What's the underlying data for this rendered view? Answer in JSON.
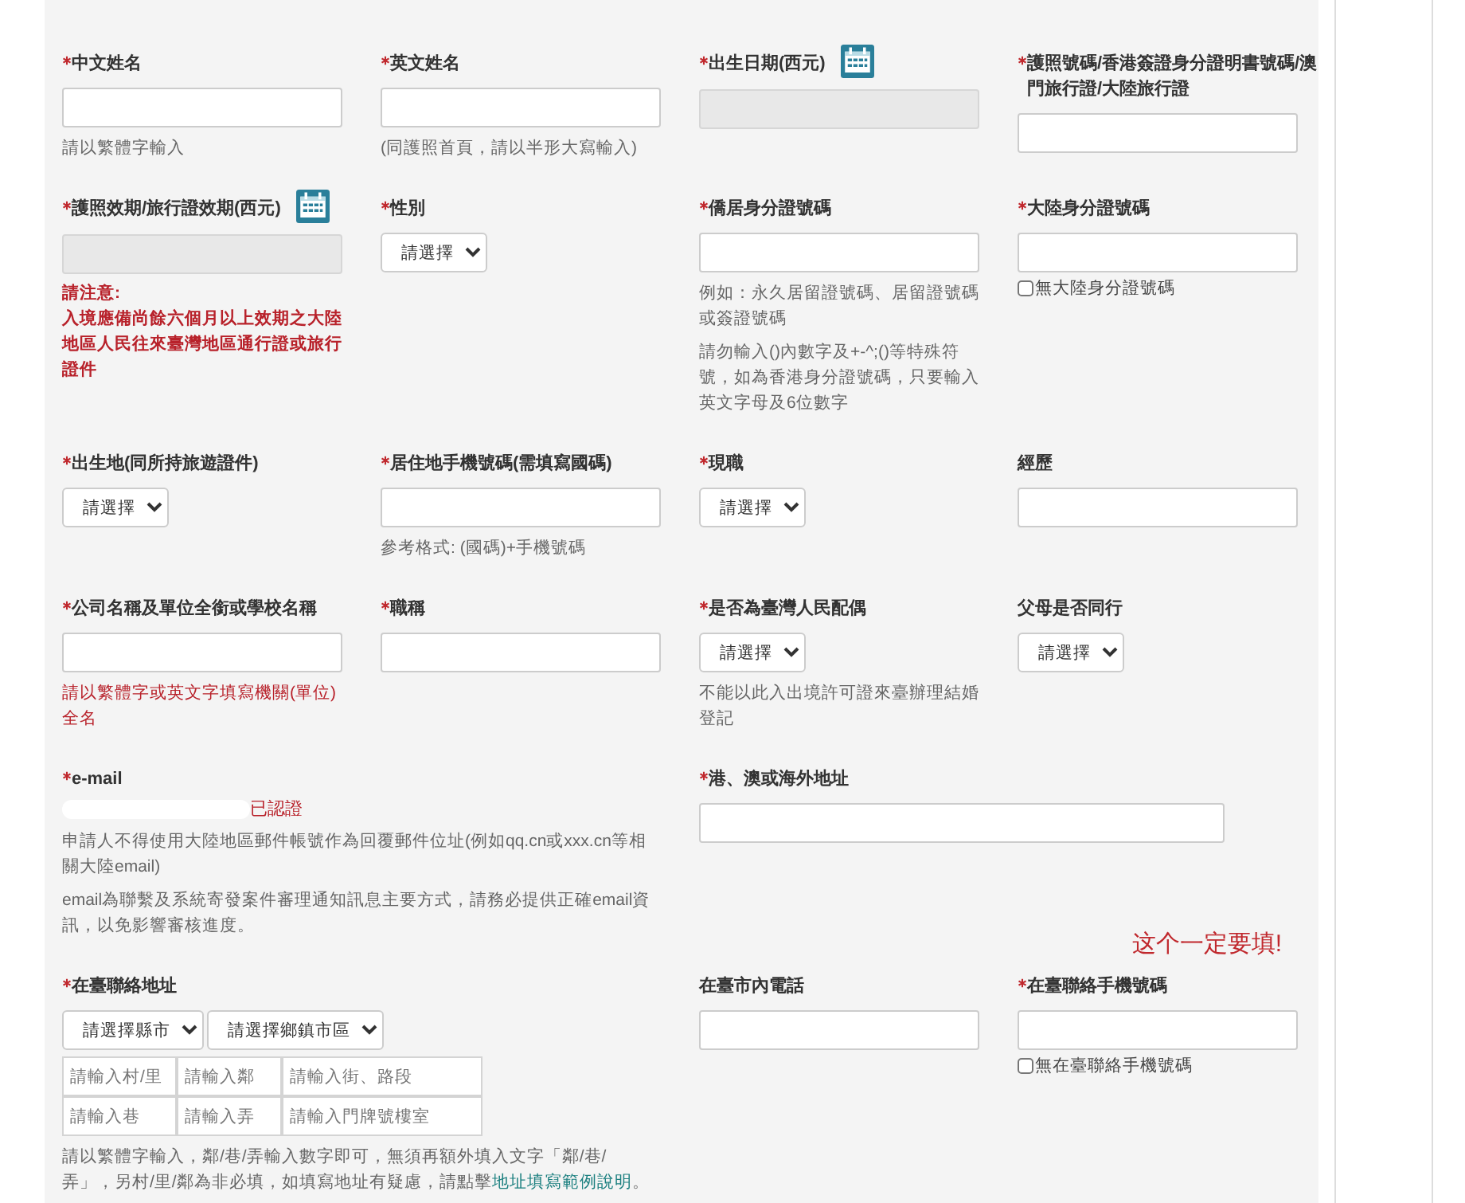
{
  "rows": [
    {
      "fields": [
        {
          "label": "中文姓名",
          "required": true,
          "kind": "text",
          "notes": [
            {
              "text": "請以繁體字輸入",
              "kind": "hint"
            }
          ]
        },
        {
          "label": "英文姓名",
          "required": true,
          "kind": "text",
          "notes": [
            {
              "text": "(同護照首頁，請以半形大寫輸入)",
              "kind": "hint"
            }
          ]
        },
        {
          "label": "出生日期(西元)",
          "required": true,
          "kind": "date"
        },
        {
          "label": "護照號碼/香港簽證身分證明書號碼/澳門旅行證/大陸旅行證",
          "required": true,
          "kind": "text"
        }
      ]
    },
    {
      "fields": [
        {
          "label": "護照效期/旅行證效期(西元)",
          "required": true,
          "kind": "date",
          "notes": [
            {
              "text": "請注意:",
              "kind": "alert"
            },
            {
              "text": "入境應備尚餘六個月以上效期之大陸地區人民往來臺灣地區通行證或旅行證件",
              "kind": "alert"
            }
          ]
        },
        {
          "label": "性別",
          "required": true,
          "kind": "select",
          "value": "請選擇"
        },
        {
          "label": "僑居身分證號碼",
          "required": true,
          "kind": "text",
          "notes": [
            {
              "text": "例如：永久居留證號碼、居留證號碼或簽證號碼",
              "kind": "hint"
            },
            {
              "text": "請勿輸入()內數字及+-^;()等特殊符號，如為香港身分證號碼，只要輸入英文字母及6位數字",
              "kind": "hint"
            }
          ]
        },
        {
          "label": "大陸身分證號碼",
          "required": true,
          "kind": "text",
          "checkbox": {
            "label": "無大陸身分證號碼",
            "checked": false
          }
        }
      ]
    },
    {
      "fields": [
        {
          "label": "出生地(同所持旅遊證件)",
          "required": true,
          "kind": "select",
          "value": "請選擇"
        },
        {
          "label": "居住地手機號碼(需填寫國碼)",
          "required": true,
          "kind": "text",
          "notes": [
            {
              "text": "參考格式: (國碼)+手機號碼",
              "kind": "hint"
            }
          ]
        },
        {
          "label": "現職",
          "required": true,
          "kind": "select",
          "value": "請選擇"
        },
        {
          "label": "經歷",
          "required": false,
          "kind": "text"
        }
      ]
    },
    {
      "fields": [
        {
          "label": "公司名稱及單位全銜或學校名稱",
          "required": true,
          "kind": "text",
          "notes": [
            {
              "text": "請以繁體字或英文字填寫機關(單位)全名",
              "kind": "error"
            }
          ]
        },
        {
          "label": "職稱",
          "required": true,
          "kind": "text"
        },
        {
          "label": "是否為臺灣人民配偶",
          "required": true,
          "kind": "select",
          "value": "請選擇",
          "notes": [
            {
              "text": "不能以此入出境許可證來臺辦理結婚登記",
              "kind": "hint"
            }
          ]
        },
        {
          "label": "父母是否同行",
          "required": false,
          "kind": "select",
          "value": "請選擇"
        }
      ]
    },
    {
      "fields": [
        {
          "label": "e-mail",
          "required": true,
          "kind": "email",
          "wide": true,
          "status": "已認證",
          "notes": [
            {
              "text": "申請人不得使用大陸地區郵件帳號作為回覆郵件位址(例如qq.cn或xxx.cn等相關大陸email)",
              "kind": "hint"
            },
            {
              "text": "email為聯繫及系統寄發案件審理通知訊息主要方式，請務必提供正確email資訊，以免影響審核進度。",
              "kind": "hint"
            }
          ]
        },
        {
          "label": "港、澳或海外地址",
          "required": true,
          "kind": "text",
          "wide": true
        }
      ]
    },
    {
      "fields": [
        {
          "label": "在臺聯絡地址",
          "required": true,
          "kind": "address",
          "wide": true,
          "selects": [
            "請選擇縣市",
            "請選擇鄉鎮市區"
          ],
          "inputs": [
            [
              {
                "placeholder": "請輸入村/里"
              },
              {
                "placeholder": "請輸入鄰"
              },
              {
                "placeholder": "請輸入街、路段"
              }
            ],
            [
              {
                "placeholder": "請輸入巷"
              },
              {
                "placeholder": "請輸入弄"
              },
              {
                "placeholder": "請輸入門牌號樓室"
              }
            ]
          ],
          "notes": [
            {
              "text": "請以繁體字輸入，鄰/巷/弄輸入數字即可，無須再額外填入文字「鄰/巷/弄」，另村/里/鄰為非必填，如填寫地址有疑慮，請點擊",
              "kind": "hint",
              "link": "地址填寫範例說明",
              "after": "。"
            }
          ]
        },
        {
          "label": "在臺市內電話",
          "required": false,
          "kind": "text"
        },
        {
          "label": "在臺聯絡手機號碼",
          "required": true,
          "kind": "text",
          "annotation": "这个一定要填!",
          "checkbox": {
            "label": "無在臺聯絡手機號碼",
            "checked": false
          }
        }
      ]
    }
  ]
}
